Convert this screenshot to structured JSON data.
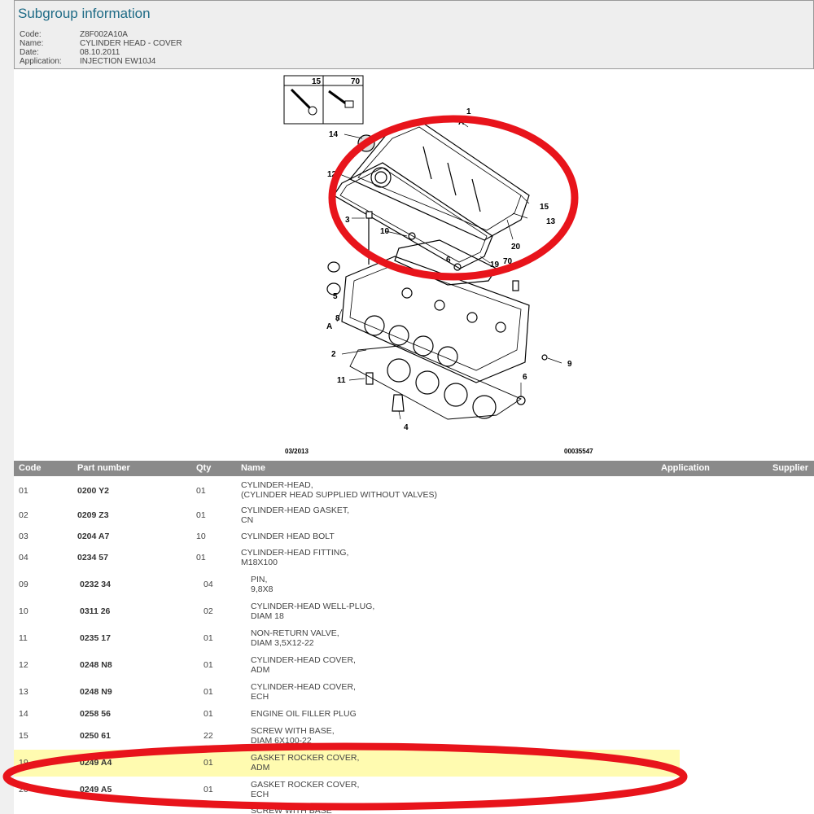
{
  "subgroup": {
    "title": "Subgroup information",
    "fields": [
      {
        "label": "Code:",
        "value": "Z8F002A10A"
      },
      {
        "label": "Name:",
        "value": "CYLINDER HEAD - COVER"
      },
      {
        "label": "Date:",
        "value": "08.10.2011"
      },
      {
        "label": "Application:",
        "value": "INJECTION EW10J4"
      }
    ]
  },
  "diagram": {
    "date": "03/2013",
    "ref": "00035547",
    "inset_labels": [
      "15",
      "70"
    ],
    "callouts": [
      "1",
      "A",
      "14",
      "12",
      "3",
      "10",
      "15",
      "13",
      "20",
      "19",
      "70",
      "6",
      "5",
      "8",
      "A",
      "2",
      "9",
      "11",
      "6",
      "4"
    ]
  },
  "table": {
    "headers": {
      "code": "Code",
      "part_number": "Part number",
      "qty": "Qty",
      "name": "Name",
      "application": "Application",
      "supplier": "Supplier"
    },
    "rows": [
      {
        "code": "01",
        "part_number": "0200 Y2",
        "qty": "01",
        "name1": "CYLINDER-HEAD,",
        "name2": "(CYLINDER HEAD SUPPLIED WITHOUT VALVES)"
      },
      {
        "code": "02",
        "part_number": "0209 Z3",
        "qty": "01",
        "name1": "CYLINDER-HEAD GASKET,",
        "name2": "CN"
      },
      {
        "code": "03",
        "part_number": "0204 A7",
        "qty": "10",
        "name1": "CYLINDER HEAD BOLT",
        "name2": ""
      },
      {
        "code": "04",
        "part_number": "0234 57",
        "qty": "01",
        "name1": "CYLINDER-HEAD FITTING,",
        "name2": "M18X100"
      },
      {
        "code": "09",
        "part_number": "0232 34",
        "qty": "04",
        "name1": "PIN,",
        "name2": "9,8X8"
      },
      {
        "code": "10",
        "part_number": "0311 26",
        "qty": "02",
        "name1": "CYLINDER-HEAD WELL-PLUG,",
        "name2": "DIAM 18"
      },
      {
        "code": "11",
        "part_number": "0235 17",
        "qty": "01",
        "name1": "NON-RETURN VALVE,",
        "name2": "DIAM 3,5X12-22"
      },
      {
        "code": "12",
        "part_number": "0248 N8",
        "qty": "01",
        "name1": "CYLINDER-HEAD COVER,",
        "name2": "ADM"
      },
      {
        "code": "13",
        "part_number": "0248 N9",
        "qty": "01",
        "name1": "CYLINDER-HEAD COVER,",
        "name2": "ECH"
      },
      {
        "code": "14",
        "part_number": "0258 56",
        "qty": "01",
        "name1": "ENGINE OIL FILLER PLUG",
        "name2": ""
      },
      {
        "code": "15",
        "part_number": "0250 61",
        "qty": "22",
        "name1": "SCREW WITH BASE,",
        "name2": "DIAM 6X100-22"
      },
      {
        "code": "19",
        "part_number": "0249 A4",
        "qty": "01",
        "name1": "GASKET ROCKER COVER,",
        "name2": "ADM"
      },
      {
        "code": "20",
        "part_number": "0249 A5",
        "qty": "01",
        "name1": "GASKET ROCKER COVER,",
        "name2": "ECH"
      },
      {
        "code": "",
        "part_number": "",
        "qty": "",
        "name1": "SCREW WITH BASE",
        "name2": ""
      }
    ]
  },
  "colors": {
    "title_blue": "#1e6b86",
    "header_gray": "#8a8a8a",
    "highlight_yellow": "#fffbb0",
    "annotation_red": "#e8141b"
  }
}
